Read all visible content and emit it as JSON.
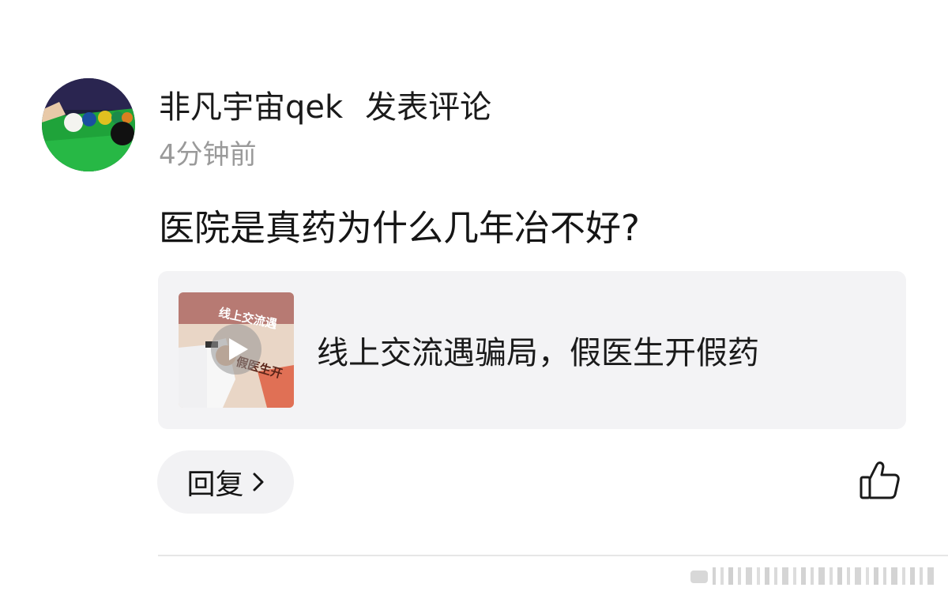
{
  "comment": {
    "username": "非凡宇宙qek",
    "action": "发表评论",
    "timestamp": "4分钟前",
    "text": "医院是真药为什么几年冶不好?"
  },
  "link_card": {
    "title": "线上交流遇骗局，假医生开假药",
    "thumbnail_caption_top": "线上交流遇",
    "thumbnail_caption_bottom": "假医生开",
    "thumbnail_icon": "play-icon"
  },
  "actions": {
    "reply_label": "回复",
    "reply_icon": "chevron-right-icon",
    "like_icon": "thumbs-up-icon"
  },
  "colors": {
    "card_background": "#f3f3f5",
    "timestamp": "#9a9a9a",
    "text": "#151515"
  }
}
